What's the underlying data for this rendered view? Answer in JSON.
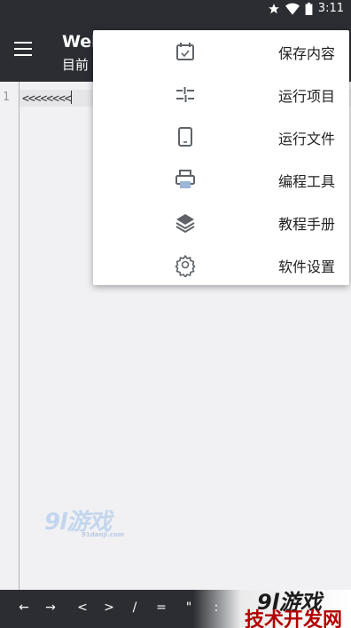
{
  "status_bar": {
    "time": "3:11",
    "icons": [
      "star-icon",
      "wifi-icon",
      "battery-icon"
    ]
  },
  "app_bar": {
    "title": "Web",
    "subtitle": "目前"
  },
  "editor": {
    "line_numbers": [
      "1"
    ],
    "code": "<<<<<<<<"
  },
  "overflow_menu": {
    "items": [
      {
        "label": "保存内容",
        "icon": "calendar-check-icon"
      },
      {
        "label": "运行项目",
        "icon": "sliders-icon"
      },
      {
        "label": "运行文件",
        "icon": "phone-icon"
      },
      {
        "label": "编程工具",
        "icon": "printer-icon"
      },
      {
        "label": "教程手册",
        "icon": "layers-icon"
      },
      {
        "label": "软件设置",
        "icon": "gear-icon"
      }
    ]
  },
  "key_toolbar": {
    "keys": [
      "←",
      "→",
      "<",
      ">",
      "/",
      "=",
      "\"",
      ":"
    ]
  },
  "watermarks": {
    "middle": "9l游戏",
    "middle_url": "91danji.com",
    "bottom_brand": "9l游戏",
    "bottom_text": "技术开发网"
  },
  "colors": {
    "appbar": "#2b2d33",
    "editor_bg": "#f1f1f4",
    "icon_gray": "#5f6368"
  }
}
